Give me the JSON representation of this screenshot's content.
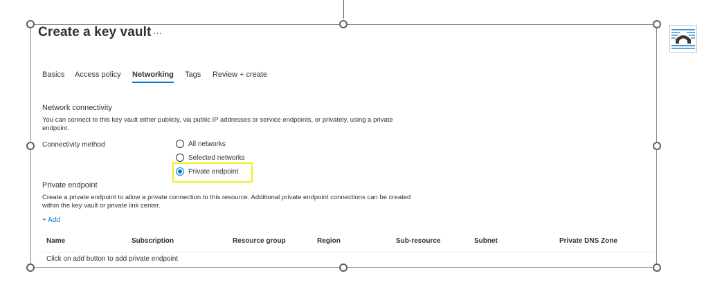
{
  "header": {
    "title": "Create a key vault",
    "more_label": "···"
  },
  "tabs": [
    {
      "label": "Basics",
      "active": false
    },
    {
      "label": "Access policy",
      "active": false
    },
    {
      "label": "Networking",
      "active": true
    },
    {
      "label": "Tags",
      "active": false
    },
    {
      "label": "Review + create",
      "active": false
    }
  ],
  "network": {
    "title": "Network connectivity",
    "description": "You can connect to this key vault either publicly, via public IP addresses or service endpoints, or privately, using a private endpoint.",
    "method_label": "Connectivity method",
    "options": [
      {
        "label": "All networks",
        "checked": false
      },
      {
        "label": "Selected networks",
        "checked": false
      },
      {
        "label": "Private endpoint",
        "checked": true
      }
    ]
  },
  "private_endpoint": {
    "title": "Private endpoint",
    "description": "Create a private endpoint to allow a private connection to this resource. Additional private endpoint connections can be created within the key vault or private link center.",
    "add_label": "+ Add",
    "columns": [
      "Name",
      "Subscription",
      "Resource group",
      "Region",
      "Sub-resource",
      "Subnet",
      "Private DNS Zone"
    ],
    "empty_text": "Click on add button to add private endpoint"
  },
  "colors": {
    "accent": "#0078d4",
    "highlight": "#f2ee1d"
  },
  "side_icon": "bridge-icon"
}
